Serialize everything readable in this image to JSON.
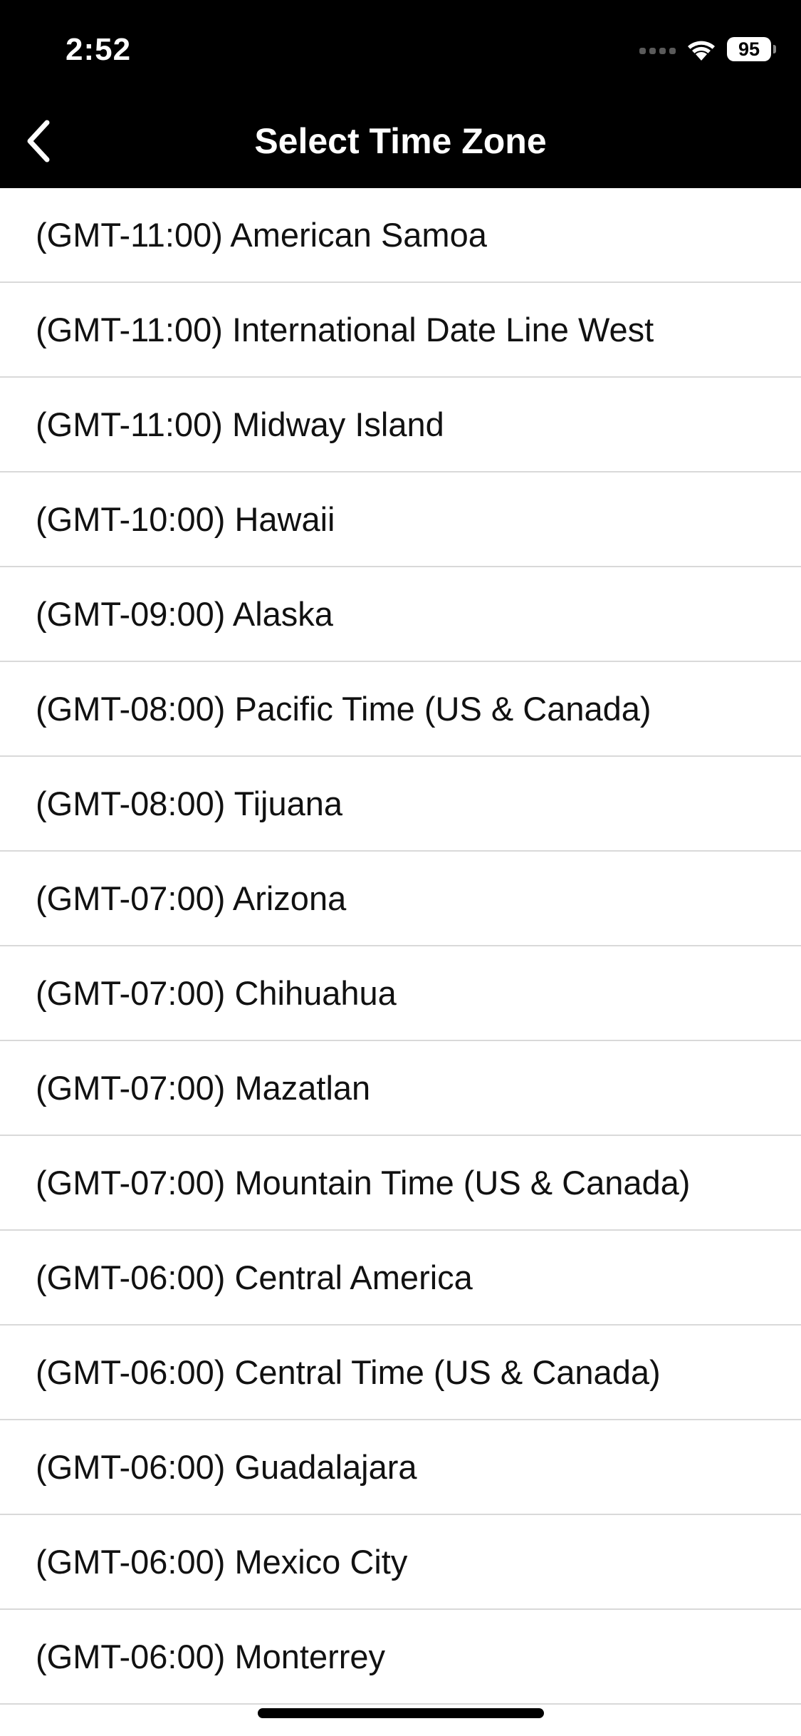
{
  "status_bar": {
    "time": "2:52",
    "battery": "95"
  },
  "header": {
    "title": "Select Time Zone",
    "back_icon": "chevron-left-icon"
  },
  "time_zones": [
    "(GMT-11:00) American Samoa",
    "(GMT-11:00) International Date Line West",
    "(GMT-11:00) Midway Island",
    "(GMT-10:00) Hawaii",
    "(GMT-09:00) Alaska",
    "(GMT-08:00) Pacific Time (US & Canada)",
    "(GMT-08:00) Tijuana",
    "(GMT-07:00) Arizona",
    "(GMT-07:00) Chihuahua",
    "(GMT-07:00) Mazatlan",
    "(GMT-07:00) Mountain Time (US & Canada)",
    "(GMT-06:00) Central America",
    "(GMT-06:00) Central Time (US & Canada)",
    "(GMT-06:00) Guadalajara",
    "(GMT-06:00) Mexico City",
    "(GMT-06:00) Monterrey"
  ],
  "colors": {
    "header_bg": "#000000",
    "header_text": "#ffffff",
    "row_text": "#111111",
    "divider": "#d9d9d9"
  }
}
